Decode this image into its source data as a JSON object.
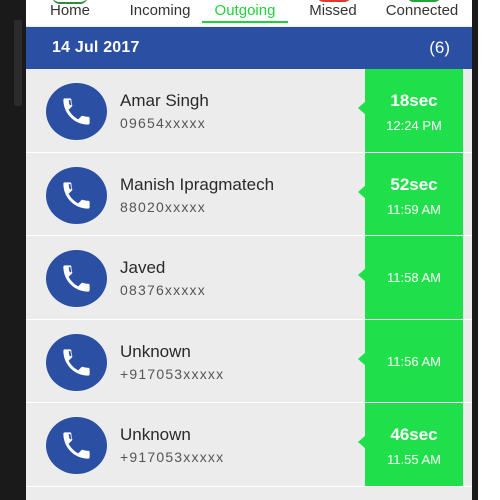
{
  "tabs": [
    {
      "id": "home",
      "label": "Home"
    },
    {
      "id": "incoming",
      "label": "Incoming"
    },
    {
      "id": "outgoing",
      "label": "Outgoing",
      "active": true
    },
    {
      "id": "missed",
      "label": "Missed"
    },
    {
      "id": "connected",
      "label": "Connected"
    }
  ],
  "colors": {
    "header_bg": "#2b4fa2",
    "active_tab": "#1fd13a",
    "duration_panel": "#1fe04a",
    "avatar_bg": "#2b4fa2"
  },
  "date_group": {
    "date": "14 Jul 2017",
    "count": "(6)"
  },
  "calls": [
    {
      "name": "Amar Singh",
      "number": "09654xxxxx",
      "duration": "18sec",
      "time": "12:24 PM",
      "icon": "phone-icon"
    },
    {
      "name": "Manish Ipragmatech",
      "number": "88020xxxxx",
      "duration": "52sec",
      "time": "11:59 AM",
      "icon": "phone-icon"
    },
    {
      "name": "Javed",
      "number": "08376xxxxx",
      "duration": "",
      "time": "11:58 AM",
      "icon": "phone-icon"
    },
    {
      "name": "Unknown",
      "number": "+917053xxxxx",
      "duration": "",
      "time": "11:56 AM",
      "icon": "phone-icon"
    },
    {
      "name": "Unknown",
      "number": "+917053xxxxx",
      "duration": "46sec",
      "time": "11.55 AM",
      "icon": "phone-icon"
    }
  ]
}
